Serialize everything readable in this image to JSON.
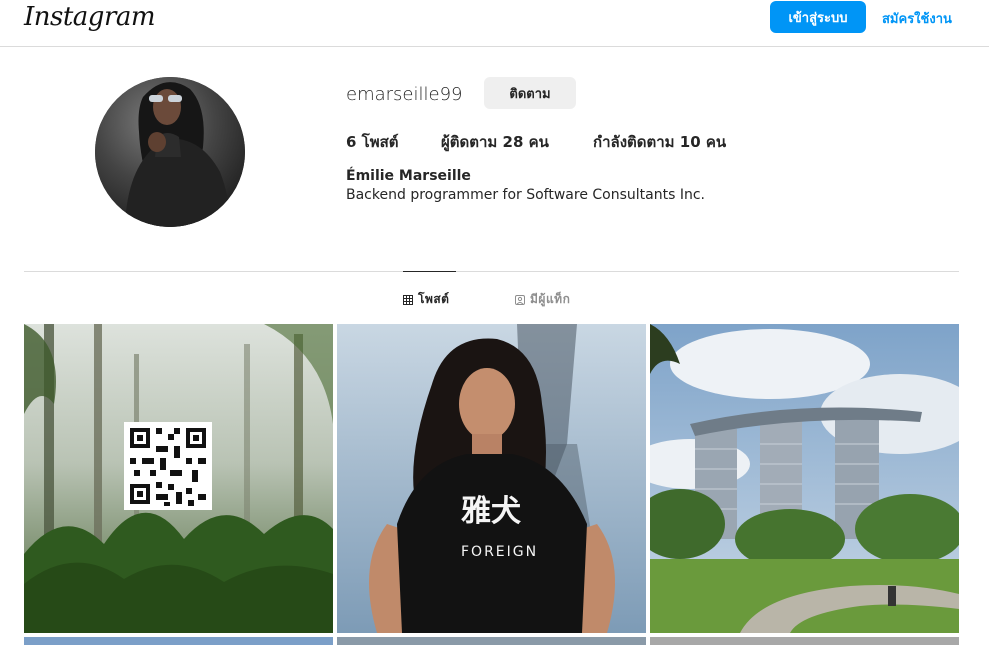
{
  "header": {
    "logo_text": "Instagram",
    "login_label": "เข้าสู่ระบบ",
    "signup_label": "สมัครใช้งาน",
    "accent_color": "#0095f6"
  },
  "profile": {
    "username": "emarseille99",
    "follow_label": "ติดตาม",
    "stats": {
      "posts": "6 โพสต์",
      "followers": "ผู้ติดตาม 28 คน",
      "following": "กำลังติดตาม 10 คน"
    },
    "full_name": "Émilie Marseille",
    "bio": "Backend programmer for Software Consultants Inc."
  },
  "tabs": [
    {
      "label": "โพสต์",
      "icon": "grid-icon",
      "active": true
    },
    {
      "label": "มีผู้แท็ก",
      "icon": "tagged-person-icon",
      "active": false
    }
  ],
  "posts": [
    {
      "name": "post-forest-qr",
      "text": ""
    },
    {
      "name": "post-woman-tshirt",
      "text": "雅犬 FOREIGN"
    },
    {
      "name": "post-marina-bay-sands",
      "text": ""
    }
  ]
}
